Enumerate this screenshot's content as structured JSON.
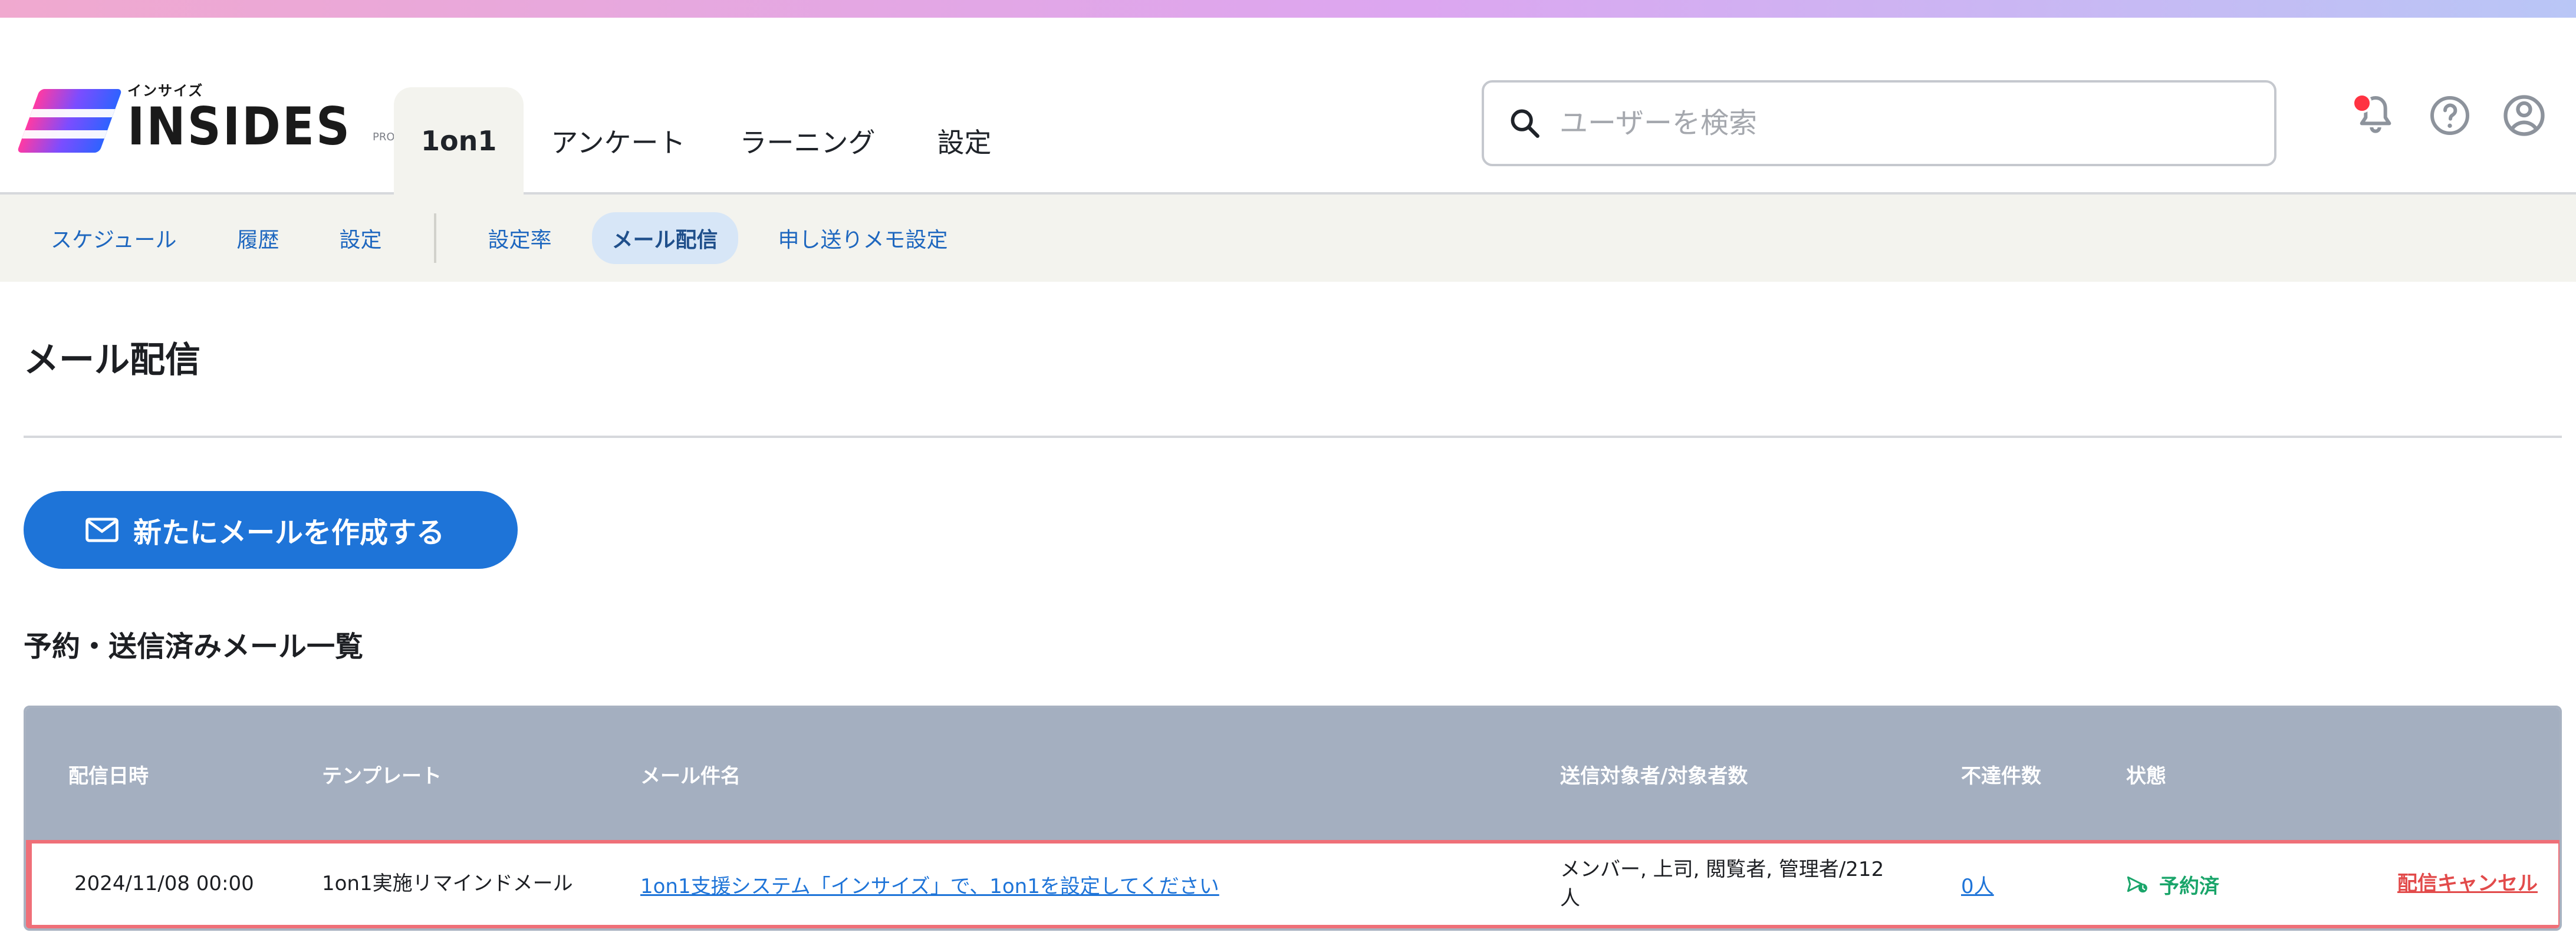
{
  "brand": {
    "small": "インサイズ",
    "name": "INSIDES",
    "credit": "PRODUCED BY Ameba"
  },
  "header": {
    "main_tabs": [
      {
        "label": "1on1",
        "active": true
      },
      {
        "label": "アンケート",
        "active": false
      },
      {
        "label": "ラーニング",
        "active": false
      },
      {
        "label": "設定",
        "active": false
      }
    ],
    "search": {
      "placeholder": "ユーザーを検索"
    }
  },
  "subnav": {
    "items": [
      {
        "label": "スケジュール",
        "active": false
      },
      {
        "label": "履歴",
        "active": false
      },
      {
        "label": "設定",
        "active": false
      },
      {
        "label": "設定率",
        "active": false
      },
      {
        "label": "メール配信",
        "active": true
      },
      {
        "label": "申し送りメモ設定",
        "active": false
      }
    ]
  },
  "page": {
    "title": "メール配信",
    "create_button": "新たにメールを作成する",
    "list_title": "予約・送信済みメール一覧"
  },
  "table": {
    "headers": [
      "配信日時",
      "テンプレート",
      "メール件名",
      "送信対象者/対象者数",
      "不達件数",
      "状態",
      ""
    ],
    "rows": [
      {
        "datetime": "2024/11/08 00:00",
        "template": "1on1実施リマインドメール",
        "subject": "1on1支援システム「インサイズ」で、1on1を設定してください",
        "targets": "メンバー, 上司, 閲覧者, 管理者/212人",
        "unreachable": "0人",
        "status": "予約済",
        "action": "配信キャンセル"
      }
    ]
  },
  "colors": {
    "accent": "#1e74d8",
    "danger": "#e24b4b",
    "success": "#1aa56a",
    "table_header": "#a4afc0"
  }
}
